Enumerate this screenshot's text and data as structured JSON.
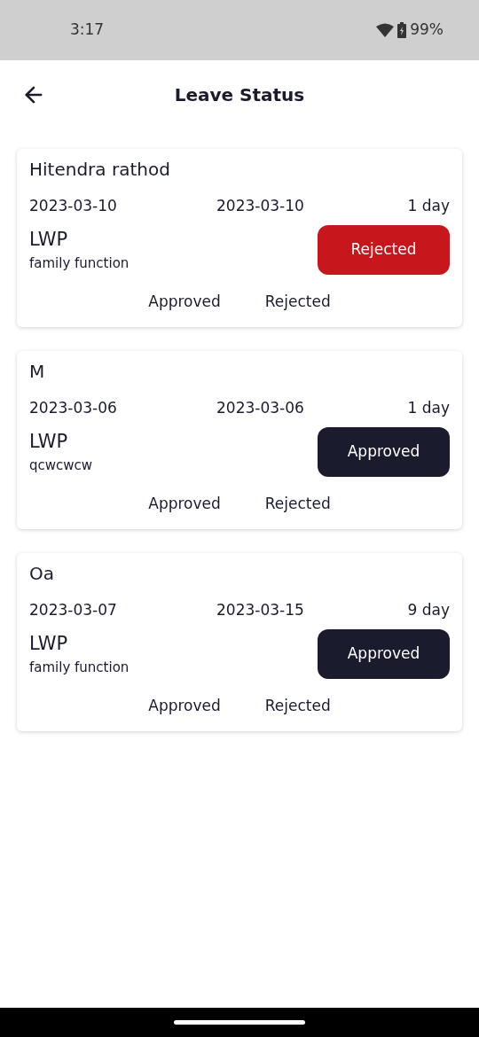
{
  "status_bar": {
    "time": "3:17",
    "battery": "99%"
  },
  "header": {
    "title": "Leave Status"
  },
  "leaves": [
    {
      "name": "Hitendra rathod",
      "from": "2023-03-10",
      "to": "2023-03-10",
      "duration": "1 day",
      "type": "LWP",
      "reason": "family function",
      "status": {
        "label": "Rejected",
        "kind": "rejected"
      },
      "actions": [
        "Approved",
        "Rejected"
      ]
    },
    {
      "name": "M",
      "from": "2023-03-06",
      "to": "2023-03-06",
      "duration": "1 day",
      "type": "LWP",
      "reason": "qcwcwcw",
      "status": {
        "label": "Approved",
        "kind": "approved"
      },
      "actions": [
        "Approved",
        "Rejected"
      ]
    },
    {
      "name": "Oa",
      "from": "2023-03-07",
      "to": "2023-03-15",
      "duration": "9 day",
      "type": "LWP",
      "reason": "family function",
      "status": {
        "label": "Approved",
        "kind": "approved"
      },
      "actions": [
        "Approved",
        "Rejected"
      ]
    }
  ]
}
